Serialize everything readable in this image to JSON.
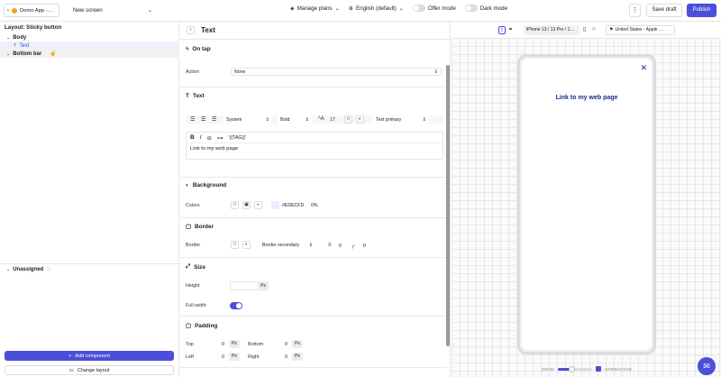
{
  "topbar": {
    "app_name": "Demo App -…",
    "screen_name": "New screen",
    "manage_plans": "Manage plans",
    "language": "English (default)",
    "offer_mode": "Offer mode",
    "dark_mode": "Dark mode",
    "save_draft": "Save draft",
    "publish": "Publish"
  },
  "left": {
    "layout_title": "Layout: Sticky button",
    "tree": {
      "body": "Body",
      "text": "Text",
      "bottom_bar": "Bottom bar",
      "unassigned": "Unassigned"
    },
    "add_component": "Add component",
    "change_layout": "Change layout"
  },
  "editor": {
    "title": "Text",
    "on_tap": {
      "title": "On tap",
      "action_label": "Action",
      "action_value": "None"
    },
    "text": {
      "title": "Text",
      "font": "System",
      "weight": "Bold",
      "size": "17",
      "color": "Text primary",
      "variable": "'{{TAG}}'",
      "content": "Link to my web page"
    },
    "background": {
      "title": "Background",
      "colors_label": "Colors",
      "hex": "#EDECFD",
      "opacity": "0%"
    },
    "border": {
      "title": "Border",
      "label": "Border",
      "style": "Border secondary",
      "width": "0",
      "radius": "0"
    },
    "size": {
      "title": "Size",
      "height_label": "Height",
      "unit": "Px",
      "full_width_label": "Full width"
    },
    "padding": {
      "title": "Padding",
      "top_label": "Top",
      "top_value": "0",
      "bottom_label": "Bottom",
      "bottom_value": "0",
      "left_label": "Left",
      "left_value": "0",
      "right_label": "Right",
      "right_value": "0",
      "unit": "Px"
    }
  },
  "preview": {
    "device": "iPhone 13 / 13 Pro / 1…",
    "locale": "United States - Apple …",
    "link_text": "Link to my web page",
    "zoom_label": "ZOOM",
    "interactive_label": "INTERACTIVE"
  },
  "colors": {
    "accent": "#4b4fd9",
    "link": "#1f2a8f"
  }
}
